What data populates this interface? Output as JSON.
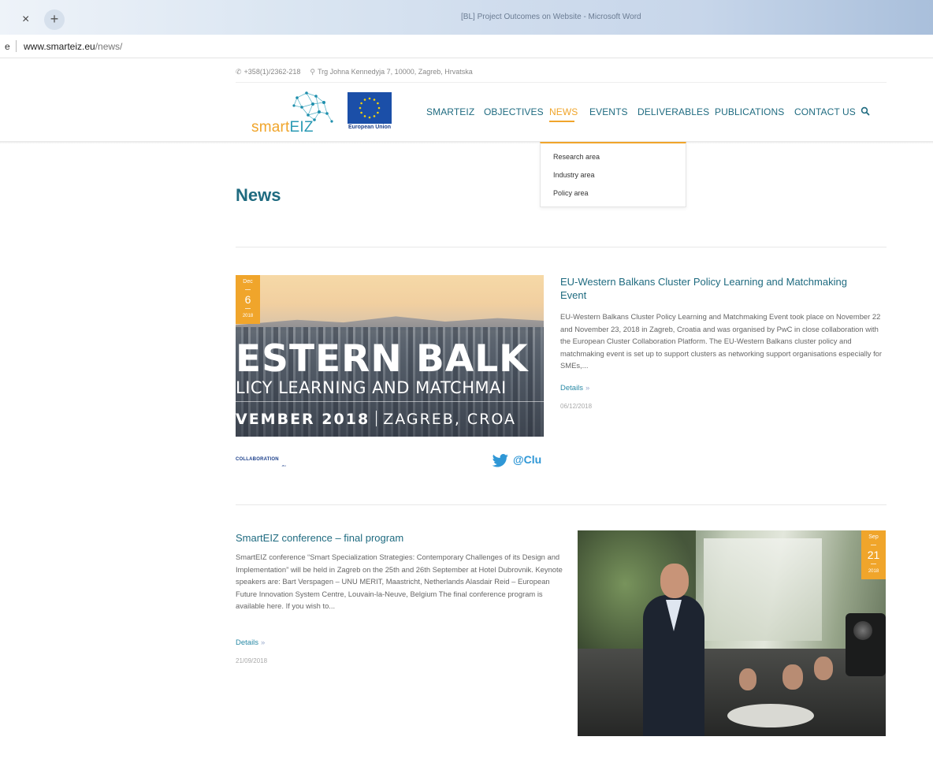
{
  "browser": {
    "tab_close": "×",
    "new_tab": "+",
    "window_title": "[BL] Project Outcomes on Website - Microsoft Word",
    "url_cut": "e",
    "url_domain": "www.smarteiz.eu",
    "url_path": "/news/"
  },
  "site": {
    "phone": "+358(1)/2362-218",
    "address": "Trg Johna Kennedyja 7, 10000, Zagreb, Hrvatska",
    "logo_smart": "smart",
    "logo_eiz": "EIZ",
    "eu_label": "European Union",
    "accent": "#f0a52b",
    "teal": "#1f6b80"
  },
  "nav": {
    "items": [
      {
        "label": "SMARTEIZ",
        "active": false
      },
      {
        "label": "OBJECTIVES",
        "active": false
      },
      {
        "label": "NEWS",
        "active": true
      },
      {
        "label": "EVENTS",
        "active": false
      },
      {
        "label": "DELIVERABLES",
        "active": false
      },
      {
        "label": "PUBLICATIONS",
        "active": false
      },
      {
        "label": "CONTACT US",
        "active": false
      }
    ],
    "search_icon": "search-icon",
    "dropdown": [
      "Research area",
      "Industry area",
      "Policy area"
    ]
  },
  "page": {
    "title": "News"
  },
  "articles": [
    {
      "badge": {
        "month": "Dec",
        "day": "6",
        "year": "2018"
      },
      "image_overlay": {
        "line1": "ESTERN BALK",
        "line2": "LICY LEARNING AND MATCHMAI",
        "line3_bold": "VEMBER 2018",
        "line3_rest": "ZAGREB, CROA",
        "collab": "COLLABORATION",
        "collab_sub": ".eu",
        "handle": "@Clu"
      },
      "title": "EU-Western Balkans Cluster Policy Learning and Matchmaking Event",
      "excerpt": "EU-Western Balkans Cluster Policy Learning and Matchmaking Event took place on November 22 and November 23, 2018 in Zagreb, Croatia and was organised by PwC in close collaboration with the European Cluster Collaboration Platform. The EU-Western Balkans cluster policy and matchmaking event is set up to support clusters as networking support organisations especially for SMEs,...",
      "details": "Details",
      "date": "06/12/2018"
    },
    {
      "badge": {
        "month": "Sep",
        "day": "21",
        "year": "2018"
      },
      "title": "SmartEIZ conference – final program",
      "excerpt": "SmartEIZ conference “Smart Specialization Strategies: Contemporary Challenges of its Design and Implementation” will be held in Zagreb on the 25th and 26th September at Hotel Dubrovnik.   Keynote speakers are: Bart Verspagen – UNU MERIT, Maastricht, Netherlands Alasdair Reid – European Future Innovation System Centre, Louvain-la-Neuve, Belgium   The final conference program is available here. If you wish to...",
      "details": "Details",
      "date": "21/09/2018"
    }
  ]
}
